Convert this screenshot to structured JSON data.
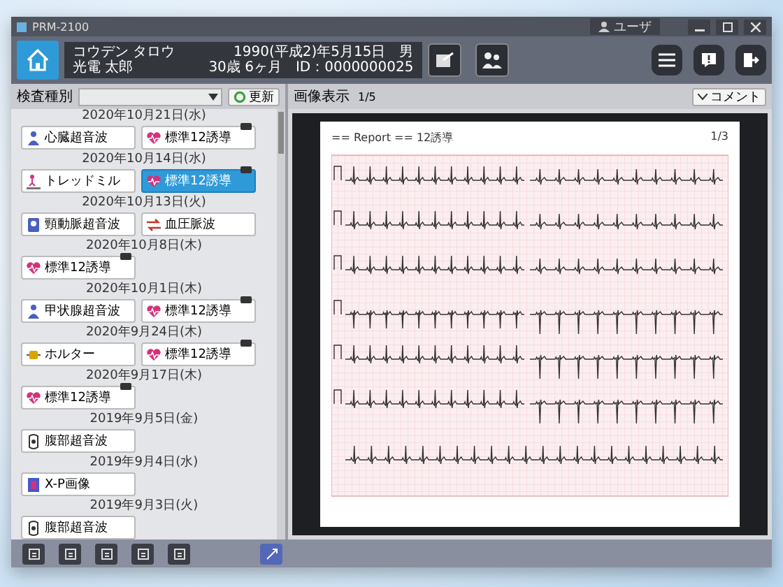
{
  "window": {
    "title": "PRM-2100",
    "user": "ユーザ"
  },
  "patient": {
    "kana": "コウデン タロウ",
    "name": "光電 太郎",
    "birth": "1990(平成2)年5月15日",
    "sex": "男",
    "age": "30歳 6ヶ月",
    "id": "ID：0000000025"
  },
  "filter": {
    "label": "検査種別",
    "refresh": "更新"
  },
  "viewer": {
    "label": "画像表示",
    "page": "1/5",
    "comment": "コメント",
    "report_title": "== Report == 12誘導",
    "report_page": "1/3"
  },
  "exams": [
    {
      "date": "2020年10月21日(水)",
      "tests": [
        {
          "kind": "person",
          "label": "心臓超音波",
          "selected": false
        },
        {
          "kind": "heart",
          "label": "標準12誘導",
          "selected": false
        }
      ]
    },
    {
      "date": "2020年10月14日(水)",
      "tests": [
        {
          "kind": "treadmill",
          "label": "トレッドミル",
          "selected": false
        },
        {
          "kind": "heart",
          "label": "標準12誘導",
          "selected": true
        }
      ]
    },
    {
      "date": "2020年10月13日(火)",
      "tests": [
        {
          "kind": "scan",
          "label": "頸動脈超音波",
          "selected": false
        },
        {
          "kind": "arrows",
          "label": "血圧脈波",
          "selected": false
        }
      ]
    },
    {
      "date": "2020年10月8日(木)",
      "tests": [
        {
          "kind": "heart",
          "label": "標準12誘導",
          "selected": false
        }
      ]
    },
    {
      "date": "2020年10月1日(木)",
      "tests": [
        {
          "kind": "person",
          "label": "甲状腺超音波",
          "selected": false
        },
        {
          "kind": "heart",
          "label": "標準12誘導",
          "selected": false
        }
      ]
    },
    {
      "date": "2020年9月24日(木)",
      "tests": [
        {
          "kind": "holter",
          "label": "ホルター",
          "selected": false
        },
        {
          "kind": "heart",
          "label": "標準12誘導",
          "selected": false
        }
      ]
    },
    {
      "date": "2020年9月17日(木)",
      "tests": [
        {
          "kind": "heart",
          "label": "標準12誘導",
          "selected": false
        }
      ]
    },
    {
      "date": "2019年9月5日(金)",
      "tests": [
        {
          "kind": "abdomen",
          "label": "腹部超音波",
          "selected": false
        }
      ]
    },
    {
      "date": "2019年9月4日(水)",
      "tests": [
        {
          "kind": "xray",
          "label": "X-P画像",
          "selected": false
        }
      ]
    },
    {
      "date": "2019年9月3日(火)",
      "tests": [
        {
          "kind": "abdomen",
          "label": "腹部超音波",
          "selected": false
        }
      ]
    }
  ]
}
